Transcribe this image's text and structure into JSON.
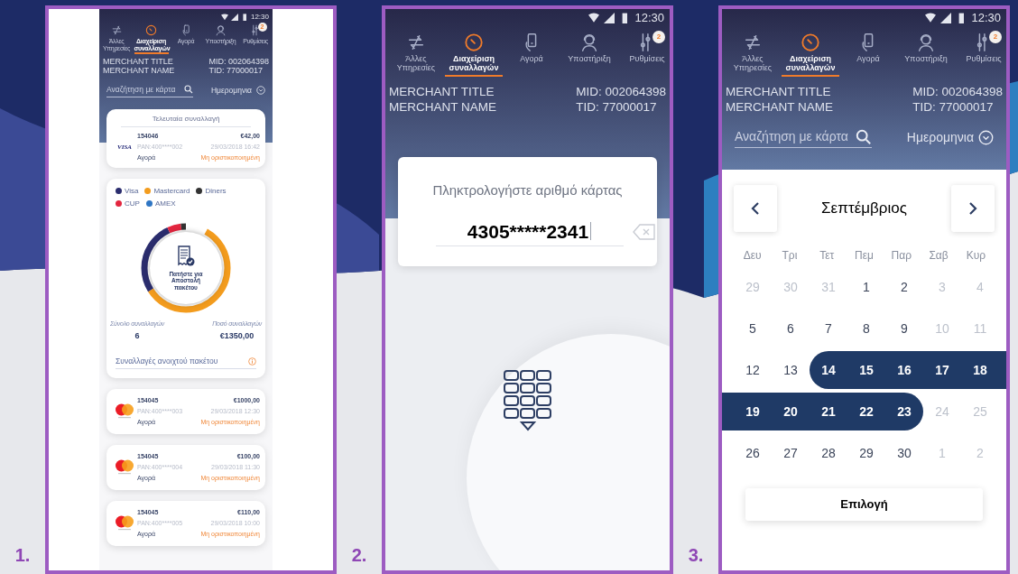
{
  "panels": [
    {
      "kind": "transactions",
      "number": "1.",
      "screen": {
        "status_time": "12:30",
        "nav": [
          {
            "label": "Άλλες Υπηρεσίες",
            "selected": false
          },
          {
            "label": "Διαχείριση συναλλαγών",
            "selected": true
          },
          {
            "label": "Αγορά",
            "selected": false
          },
          {
            "label": "Υποστήριξη",
            "selected": false
          },
          {
            "label": "Ρυθμίσεις",
            "selected": false,
            "badge": "2"
          }
        ],
        "merchant": {
          "title": "MERCHANT TITLE",
          "name": "MERCHANT NAME",
          "mid": "MID: 002064398",
          "tid": "TID: 77000017"
        },
        "search": {
          "placeholder": "Αναζήτηση με κάρτα"
        },
        "date_filter": "Ημερομηνια",
        "last_transaction": {
          "title": "Τελευταία συναλλαγή",
          "transaction": {
            "card": {
              "kind": "visa",
              "text": "VISA"
            },
            "id": "154046",
            "amount": "€42,00",
            "pan": "PAN:400****002",
            "datetime": "29/03/2018 16:42",
            "type": "Αγορά",
            "status": "Μη οριστικοποιημένη"
          }
        },
        "legend": [
          {
            "label": "Visa",
            "color": "#2b2d6e"
          },
          {
            "label": "Mastercard",
            "color": "#f39c1e"
          },
          {
            "label": "Diners",
            "color": "#333333"
          },
          {
            "label": "CUP",
            "color": "#e3263f"
          },
          {
            "label": "AMEX",
            "color": "#2f76c4"
          }
        ],
        "send_button": "Πατήστε για Αποστολή πακέτου",
        "totals": [
          {
            "label": "Σύνολο συναλλαγών",
            "value": "6"
          },
          {
            "label": "Ποσό συναλλαγών",
            "value": "€1350,00"
          }
        ],
        "open_batch_link": "Συναλλαγές ανοιχτού πακέτου",
        "transactions": [
          {
            "card": {
              "kind": "mastercard"
            },
            "id": "154045",
            "amount": "€1000,00",
            "pan": "PAN:400****003",
            "datetime": "29/03/2018 12:30",
            "type": "Αγορά",
            "status": "Μη οριστικοποιημένη"
          },
          {
            "card": {
              "kind": "mastercard"
            },
            "id": "154045",
            "amount": "€100,00",
            "pan": "PAN:400****004",
            "datetime": "29/03/2018 11:30",
            "type": "Αγορά",
            "status": "Μη οριστικοποιημένη"
          },
          {
            "card": {
              "kind": "mastercard"
            },
            "id": "154045",
            "amount": "€110,00",
            "pan": "PAN:400****005",
            "datetime": "29/03/2018 10:00",
            "type": "Αγορά",
            "status": "Μη οριστικοποιημένη"
          }
        ]
      }
    },
    {
      "kind": "card_entry",
      "number": "2.",
      "screen": {
        "status_time": "12:30",
        "nav": [
          {
            "label": "Άλλες Υπηρεσίες",
            "selected": false
          },
          {
            "label": "Διαχείριση συναλλαγών",
            "selected": true
          },
          {
            "label": "Αγορά",
            "selected": false
          },
          {
            "label": "Υποστήριξη",
            "selected": false
          },
          {
            "label": "Ρυθμίσεις",
            "selected": false,
            "badge": "2"
          }
        ],
        "merchant": {
          "title": "MERCHANT TITLE",
          "name": "MERCHANT NAME",
          "mid": "MID: 002064398",
          "tid": "TID: 77000017"
        },
        "prompt": "Πληκτρολογήστε αριθμό κάρτας",
        "card_number": "4305*****2341"
      }
    },
    {
      "kind": "calendar",
      "number": "3.",
      "screen": {
        "status_time": "12:30",
        "nav": [
          {
            "label": "Άλλες Υπηρεσίες",
            "selected": false
          },
          {
            "label": "Διαχείριση συναλλαγών",
            "selected": true
          },
          {
            "label": "Αγορά",
            "selected": false
          },
          {
            "label": "Υποστήριξη",
            "selected": false
          },
          {
            "label": "Ρυθμίσεις",
            "selected": false,
            "badge": "2"
          }
        ],
        "merchant": {
          "title": "MERCHANT TITLE",
          "name": "MERCHANT NAME",
          "mid": "MID: 002064398",
          "tid": "TID: 77000017"
        },
        "search": {
          "placeholder": "Αναζήτηση με κάρτα"
        },
        "date_filter": "Ημερομηνια",
        "calendar": {
          "month": "Σεπτέμβριος",
          "weekdays": [
            "Δευ",
            "Τρι",
            "Τετ",
            "Πεμ",
            "Παρ",
            "Σαβ",
            "Κυρ"
          ],
          "weeks": [
            [
              {
                "label": "29",
                "muted": true,
                "selected": false
              },
              {
                "label": "30",
                "muted": true,
                "selected": false
              },
              {
                "label": "31",
                "muted": true,
                "selected": false
              },
              {
                "label": "1",
                "muted": false,
                "selected": false
              },
              {
                "label": "2",
                "muted": false,
                "selected": false
              },
              {
                "label": "3",
                "muted": true,
                "selected": false
              },
              {
                "label": "4",
                "muted": true,
                "selected": false
              }
            ],
            [
              {
                "label": "5",
                "muted": false,
                "selected": false
              },
              {
                "label": "6",
                "muted": false,
                "selected": false
              },
              {
                "label": "7",
                "muted": false,
                "selected": false
              },
              {
                "label": "8",
                "muted": false,
                "selected": false
              },
              {
                "label": "9",
                "muted": false,
                "selected": false
              },
              {
                "label": "10",
                "muted": true,
                "selected": false
              },
              {
                "label": "11",
                "muted": true,
                "selected": false
              }
            ],
            [
              {
                "label": "12",
                "muted": false,
                "selected": false
              },
              {
                "label": "13",
                "muted": false,
                "selected": false
              },
              {
                "label": "14",
                "muted": false,
                "selected": true
              },
              {
                "label": "15",
                "muted": false,
                "selected": true
              },
              {
                "label": "16",
                "muted": false,
                "selected": true
              },
              {
                "label": "17",
                "muted": false,
                "selected": true
              },
              {
                "label": "18",
                "muted": false,
                "selected": true
              }
            ],
            [
              {
                "label": "19",
                "muted": false,
                "selected": true
              },
              {
                "label": "20",
                "muted": false,
                "selected": true
              },
              {
                "label": "21",
                "muted": false,
                "selected": true
              },
              {
                "label": "22",
                "muted": false,
                "selected": true
              },
              {
                "label": "23",
                "muted": false,
                "selected": true
              },
              {
                "label": "24",
                "muted": true,
                "selected": false
              },
              {
                "label": "25",
                "muted": true,
                "selected": false
              }
            ],
            [
              {
                "label": "26",
                "muted": false,
                "selected": false
              },
              {
                "label": "27",
                "muted": false,
                "selected": false
              },
              {
                "label": "28",
                "muted": false,
                "selected": false
              },
              {
                "label": "29",
                "muted": false,
                "selected": false
              },
              {
                "label": "30",
                "muted": false,
                "selected": false
              },
              {
                "label": "1",
                "muted": true,
                "selected": false
              },
              {
                "label": "2",
                "muted": true,
                "selected": false
              }
            ]
          ]
        },
        "confirm_button": "Επιλογή"
      }
    }
  ]
}
